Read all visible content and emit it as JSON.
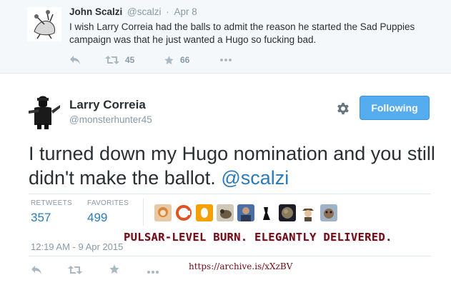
{
  "reply_tweet": {
    "name": "John Scalzi",
    "handle": "@scalzi",
    "separator": "·",
    "date": "Apr 8",
    "text": "I wish Larry Correia had the balls to admit the reason he started the Sad Puppies campaign was that he just wanted a Hugo so fucking bad.",
    "retweet_count": "45",
    "favorite_count": "66",
    "icons": [
      "reply-icon",
      "retweet-icon",
      "favorite-icon",
      "more-icon"
    ]
  },
  "main_tweet": {
    "name": "Larry Correia",
    "handle": "@monsterhunter45",
    "follow_label": "Following",
    "text_before": "I turned down my Hugo nomination and you still didn't make the ballot. ",
    "mention": "@scalzi",
    "retweets_label": "RETWEETS",
    "retweets_value": "357",
    "favorites_label": "FAVORITES",
    "favorites_value": "499",
    "timestamp": "12:19 AM - 9 Apr 2015",
    "icons": [
      "settings-gear-icon",
      "reply-icon",
      "retweet-icon",
      "favorite-icon",
      "more-icon"
    ]
  },
  "overlay": {
    "caption": "Pulsar-level burn. Elegantly delivered.",
    "link": "https://archive.is/xXzBV"
  },
  "colors": {
    "accent_blue": "#55acee",
    "link_blue": "#2b7bb9",
    "muted_gray": "#8899a6",
    "caption_red": "#6e0c18"
  }
}
